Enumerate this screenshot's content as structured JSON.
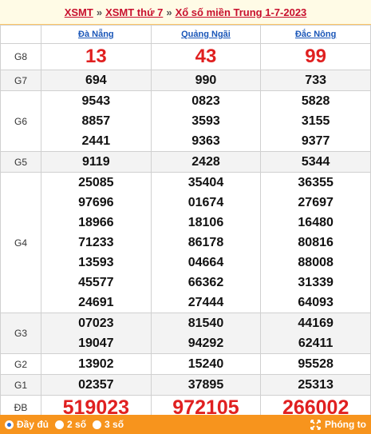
{
  "breadcrumb": {
    "items": [
      "XSMT",
      "XSMT thứ 7",
      "Xổ số miền Trung 1-7-2023"
    ],
    "separator": "»"
  },
  "provinces": [
    "Đà Nẵng",
    "Quảng Ngãi",
    "Đắc Nông"
  ],
  "prizes": [
    {
      "label": "G8",
      "values": [
        [
          "13"
        ],
        [
          "43"
        ],
        [
          "99"
        ]
      ]
    },
    {
      "label": "G7",
      "values": [
        [
          "694"
        ],
        [
          "990"
        ],
        [
          "733"
        ]
      ]
    },
    {
      "label": "G6",
      "values": [
        [
          "9543",
          "8857",
          "2441"
        ],
        [
          "0823",
          "3593",
          "9363"
        ],
        [
          "5828",
          "3155",
          "9377"
        ]
      ]
    },
    {
      "label": "G5",
      "values": [
        [
          "9119"
        ],
        [
          "2428"
        ],
        [
          "5344"
        ]
      ]
    },
    {
      "label": "G4",
      "values": [
        [
          "25085",
          "97696",
          "18966",
          "71233",
          "13593",
          "45577",
          "24691"
        ],
        [
          "35404",
          "01674",
          "18106",
          "86178",
          "04664",
          "66362",
          "27444"
        ],
        [
          "36355",
          "27697",
          "16480",
          "80816",
          "88008",
          "31339",
          "64093"
        ]
      ]
    },
    {
      "label": "G3",
      "values": [
        [
          "07023",
          "19047"
        ],
        [
          "81540",
          "94292"
        ],
        [
          "44169",
          "62411"
        ]
      ]
    },
    {
      "label": "G2",
      "values": [
        [
          "13902"
        ],
        [
          "15240"
        ],
        [
          "95528"
        ]
      ]
    },
    {
      "label": "G1",
      "values": [
        [
          "02357"
        ],
        [
          "37895"
        ],
        [
          "25313"
        ]
      ]
    },
    {
      "label": "ĐB",
      "values": [
        [
          "519023"
        ],
        [
          "972105"
        ],
        [
          "266002"
        ]
      ]
    }
  ],
  "footer": {
    "options": [
      {
        "label": "Đầy đủ",
        "selected": true
      },
      {
        "label": "2 số",
        "selected": false
      },
      {
        "label": "3 số",
        "selected": false
      }
    ],
    "zoom_label": "Phóng to"
  },
  "colors": {
    "accent": "#e02020",
    "link": "#1a56b8",
    "footer": "#f7941d"
  }
}
